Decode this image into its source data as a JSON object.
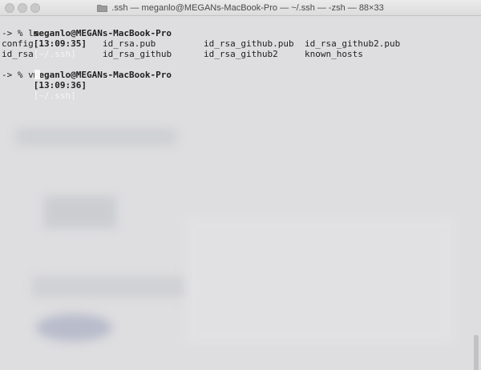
{
  "window": {
    "title": ".ssh — meganlo@MEGANs-MacBook-Pro — ~/.ssh — -zsh — 88×33",
    "folder_icon": "folder-icon"
  },
  "terminal": {
    "lines": [
      {
        "prompt_host": "meganlo@MEGANs-MacBook-Pro",
        "time": "[13:09:35]",
        "path": "[~/.ssh]"
      },
      {
        "arrow": "-> % ",
        "command": "ls"
      },
      {
        "files_row1": [
          "config",
          "id_rsa.pub",
          "id_rsa_github.pub",
          "id_rsa_github2.pub"
        ]
      },
      {
        "files_row2": [
          "id_rsa",
          "id_rsa_github",
          "id_rsa_github2",
          "known_hosts"
        ]
      },
      {
        "prompt_host": "meganlo@MEGANs-MacBook-Pro",
        "time": "[13:09:36]",
        "path": "[~/.ssh]"
      },
      {
        "arrow": "-> % ",
        "command": "v"
      }
    ]
  },
  "colors": {
    "background": "#dedee0",
    "text": "#1f1f1f",
    "path_text": "#f4f4f4",
    "cursor": "#f6f6f6"
  }
}
